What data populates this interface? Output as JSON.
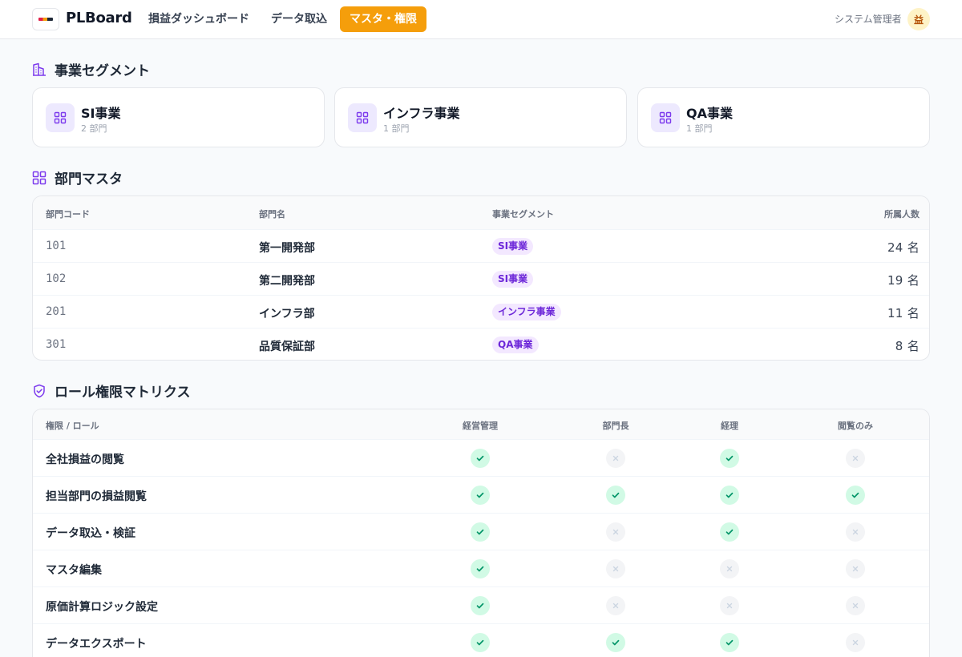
{
  "header": {
    "brand": "PLBoard",
    "nav": [
      {
        "label": "損益ダッシュボード"
      },
      {
        "label": "データ取込"
      },
      {
        "label": "マスタ・権限"
      }
    ],
    "active_nav": "マスタ・権限",
    "user_name": "システム管理者",
    "avatar_text": "益",
    "accent_color": "#f59e0b"
  },
  "segments": {
    "title": "事業セグメント",
    "icon": "building-icon",
    "items": [
      {
        "name": "SI事業",
        "count": "2 部門"
      },
      {
        "name": "インフラ事業",
        "count": "1 部門"
      },
      {
        "name": "QA事業",
        "count": "1 部門"
      }
    ]
  },
  "departments": {
    "title": "部門マスタ",
    "icon": "grid-icon",
    "columns": [
      "部門コード",
      "部門名",
      "事業セグメント",
      "所属人数"
    ],
    "rows": [
      {
        "code": "101",
        "name": "第一開発部",
        "segment": "SI事業",
        "count": "24 名"
      },
      {
        "code": "102",
        "name": "第二開発部",
        "segment": "SI事業",
        "count": "19 名"
      },
      {
        "code": "201",
        "name": "インフラ部",
        "segment": "インフラ事業",
        "count": "11 名"
      },
      {
        "code": "301",
        "name": "品質保証部",
        "segment": "QA事業",
        "count": "8 名"
      }
    ]
  },
  "roles": {
    "title": "ロール権限マトリクス",
    "icon": "shield-check-icon",
    "columns": [
      "権限 / ロール",
      "経営管理",
      "部門長",
      "経理",
      "閲覧のみ"
    ],
    "rows": [
      {
        "label": "全社損益の閲覧",
        "perms": [
          true,
          false,
          true,
          false
        ]
      },
      {
        "label": "担当部門の損益閲覧",
        "perms": [
          true,
          true,
          true,
          true
        ]
      },
      {
        "label": "データ取込・検証",
        "perms": [
          true,
          false,
          true,
          false
        ]
      },
      {
        "label": "マスタ編集",
        "perms": [
          true,
          false,
          false,
          false
        ]
      },
      {
        "label": "原価計算ロジック設定",
        "perms": [
          true,
          false,
          false,
          false
        ]
      },
      {
        "label": "データエクスポート",
        "perms": [
          true,
          true,
          true,
          false
        ]
      }
    ]
  }
}
